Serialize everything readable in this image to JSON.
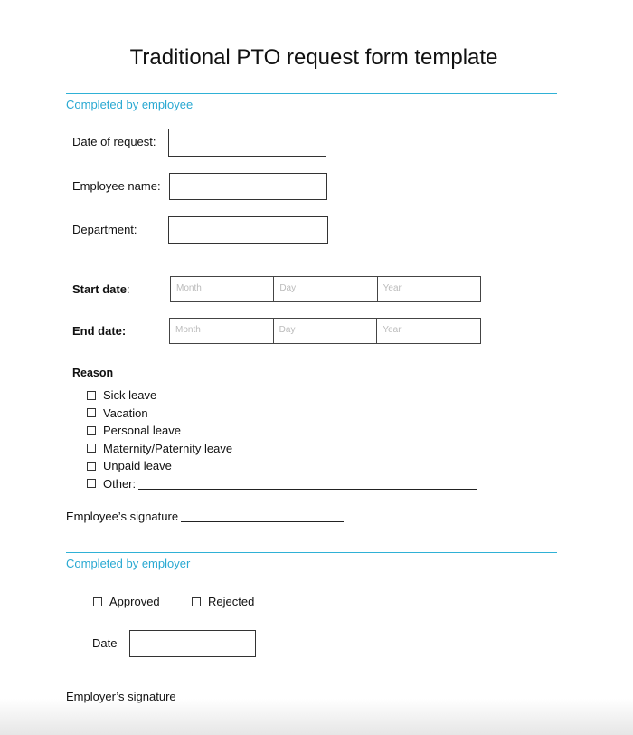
{
  "title": "Traditional PTO request form template",
  "employee_section": {
    "heading": "Completed by employee",
    "fields": [
      {
        "label": "Date of request:",
        "value": ""
      },
      {
        "label": "Employee name:",
        "value": ""
      },
      {
        "label": "Department:",
        "value": ""
      }
    ],
    "start_date": {
      "label": "Start date",
      "colon": ":",
      "placeholders": [
        "Month",
        "Day",
        "Year"
      ]
    },
    "end_date": {
      "label": "End date:",
      "placeholders": [
        "Month",
        "Day",
        "Year"
      ]
    },
    "reason": {
      "heading": "Reason",
      "options": [
        {
          "label": "Sick leave",
          "checked": false
        },
        {
          "label": "Vacation",
          "checked": false
        },
        {
          "label": "Personal leave",
          "checked": false
        },
        {
          "label": "Maternity/Paternity leave",
          "checked": false
        },
        {
          "label": "Unpaid leave",
          "checked": false
        },
        {
          "label": "Other:",
          "checked": false
        }
      ]
    },
    "signature_label": "Employee’s signature"
  },
  "employer_section": {
    "heading": "Completed by employer",
    "decision": [
      {
        "label": "Approved",
        "checked": false
      },
      {
        "label": "Rejected",
        "checked": false
      }
    ],
    "date_label": "Date",
    "signature_label": "Employer’s signature"
  },
  "colors": {
    "accent": "#2aa9d2",
    "text": "#111111",
    "placeholder": "#bbbbbb"
  }
}
